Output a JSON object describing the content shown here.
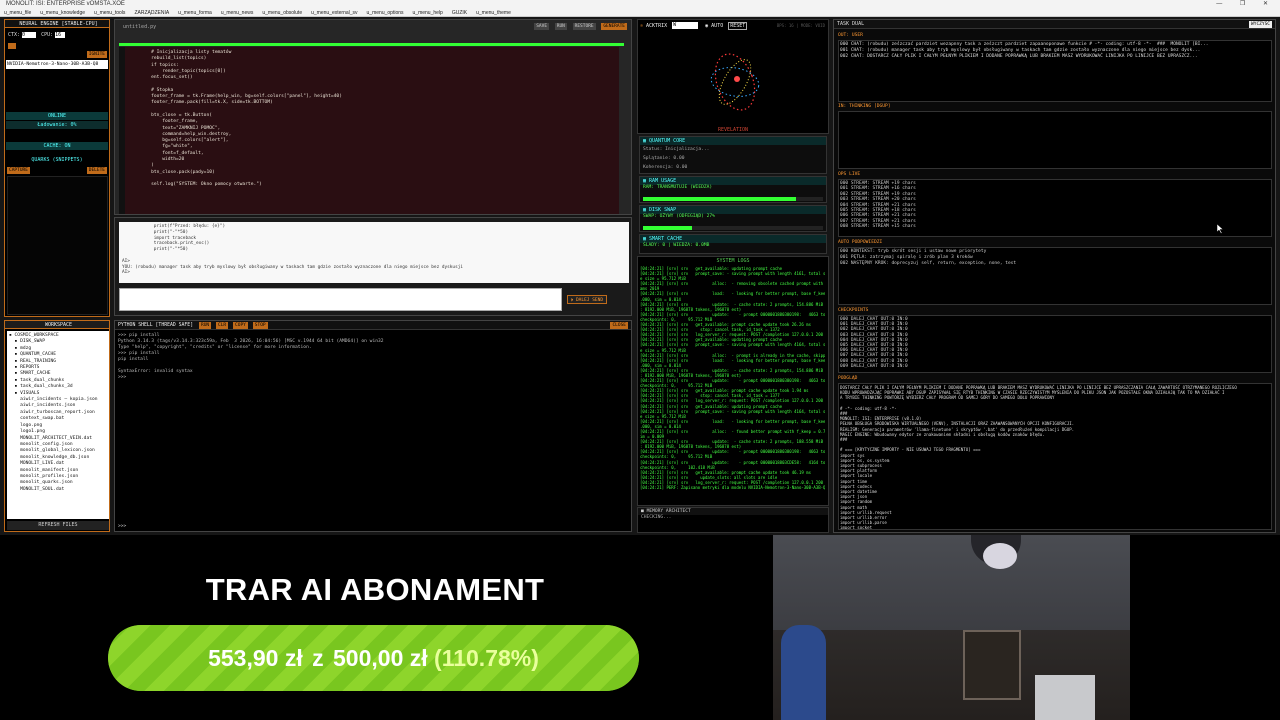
{
  "window": {
    "title": "MONOLIT: ISI: ENTERPRISE vOMSTA.XOE",
    "controls": "— ❐ ✕"
  },
  "menu": [
    "u_menu_file",
    "u_menu_knowledge",
    "u_menu_tools",
    "ZARZĄDZENIA",
    "u_menu_forma",
    "u_menu_news",
    "u_menu_obsolute",
    "u_menu_external_sv",
    "u_menu_options",
    "u_menu_help",
    "GUZIK",
    "u_menu_theme"
  ],
  "left": {
    "engine_title": "NEURAL ENGINE [STABLE-CPU]",
    "ctx_label": "CTX:",
    "ctx_value": "0",
    "cpu_label": "CPU:",
    "cpu_value": "16",
    "ignite_label": "IGNITE",
    "model_name": "NVIDIA-Nemotron-3-Nano-30B-A3B-Q8",
    "status_online": "ONLINE",
    "status_loading": "Ładowanie: 0%",
    "cache_status": "CACHE: ON",
    "quarks_title": "QUARKS (SNIPPETS)",
    "capture_label": "CAPTURE",
    "delete_label": "DELETE",
    "workspace_title": "WORKSPACE",
    "tree": [
      "▪ COSMIC_WORKSPACE",
      "  ▪ DISK_SWAP",
      "  ▪ mdzg",
      "  ▪ QUANTUM_CACHE",
      "  ▪ REAL_TRAINING",
      "  ▪ REPORTS",
      "  ▪ SMART_CACHE",
      "  ▪ task_dual_chunks",
      "  ▪ task_dual_chunks_3d",
      "  ▪ VISUALS",
      "    aiwir_incidents — kopia.json",
      "    aiwir_incidents.json",
      "    aiwir_turboscan_report.json",
      "    context_swap.bat",
      "    logo.png",
      "    logo1.png",
      "    MONOLIT_ARCHITECT_VEIN.dat",
      "    monolit_config.json",
      "    monolit_global_lexicon.json",
      "    monolit_knowledge_db.json",
      "    MONOLIT_LIVE.dat",
      "    monolit_manifest.json",
      "    monolit_profiles.json",
      "    monolit_quarks.json",
      "    MONOLIT_SOUL.dat"
    ],
    "refresh_label": "REFRESH FILES"
  },
  "editor": {
    "filename": "untitled.py",
    "tabs": [
      "SAVE",
      "RUN",
      "RESTORE",
      "GENERATE"
    ],
    "code": "        # Inicjalizacja listy tematów\n        rebuild_list(topics)\n        if topics:\n            render_topic(topics[0])\n        ent.focus_set()\n\n        # Stopka\n        footer_frame = tk.Frame(help_win, bg=self.colors[\"panel\"], height=40)\n        footer_frame.pack(fill=tk.X, side=tk.BOTTOM)\n\n        btn_close = tk.Button(\n            footer_frame,\n            text=\"ZAMKNIJ POMOC\",\n            command=help_win.destroy,\n            bg=self.colors[\"alert\"],\n            fg=\"white\",\n            font=f_default,\n            width=20\n        )\n        btn_close.pack(pady=10)\n\n        self.log(\"SYSTEM: Okno pomocy otwarte.\")"
  },
  "chat": {
    "text": "            print(f\"Przed: błędu: {e}\")\n            print(\"-\"*50)\n            import traceback\n            traceback.print_exc()\n            print(\"-\"*50)\n\nAI>\nYOU: (robudu) manager task aby tryb myslowy był obsługiwany w taskach tam gdzie zostało wyznaczone dla niego miejsce bez dyskusji\nAI>",
    "input_placeholder": "",
    "send_label": "⏵ DALEJ SEND"
  },
  "shell": {
    "title": "PYTHON SHELL [THREAD SAFE]",
    "buttons": [
      "RUN",
      "CLR",
      "COPY",
      "STOP"
    ],
    "close": "CLOSE",
    "output": ">>> pip install\nPython 3.14.3 (tags/v3.14.3:323c59a, Feb  3 2026, 16:04:56) [MSC v.1944 64 bit (AMD64)] on win32\nType \"help\", \"copyright\", \"credits\" or \"license\" for more information.\n>>> pip install\npip install\n\nSyntaxError: invalid syntax\n>>>",
    "prompt": ">>>"
  },
  "monitor": {
    "title": "ACKTRIX",
    "input_value": "W",
    "auto_label": "AUTO",
    "reset_label": "RESET",
    "stats": "BPS: 16  |  MODE: VOID",
    "revelation": "REVELATION",
    "quantum_title": "QUANTUM CORE",
    "quantum_lines": [
      "Status: Inicjalizacja...",
      "Splątanie: 0.00",
      "Koherencja: 0.00"
    ],
    "ram_title": "RAM USAGE",
    "ram_line": "RAM: TRANSMUTUJE (WIEDZA)",
    "ram_fill": 0.85,
    "disk_title": "DISK SWAP",
    "disk_line": "SWAP: OŻYWY (ODFEGIĄD) 27%",
    "disk_fill": 0.27,
    "cache_title": "SMART CACHE",
    "cache_line": "ŚLADY: 0 | WIEDZA: 0.0MB",
    "logs_title": "SYSTEM LOGS",
    "logs": [
      "[04:24:21] [srv] srv   get_available: updating prompt cache",
      "[04:24:21] [srv] srv   prompt_save: - saving prompt with length 4161, total stat",
      "e size = 95.712 MiB",
      "[04:24:21] [srv] srv          alloc:  - removing obsolete cached prompt with (ngr",
      "ams 2019",
      "[04:24:21] [srv] srv          load:   - looking for better prompt, base f_keep = 1",
      ".000, sim = 0.014",
      "[04:24:21] [srv] srv          update:  - cache state: 2 prompts, 154.886 MiB (limit",
      ": 8192.000 MiB, 196878 tokens, 196878 est)",
      "[04:24:21] [srv] srv          update:    - prompt 0000001880380198:   4663 tokens,",
      "checkpoints: 0,     95.712 MiB",
      "[04:24:21] [srv] srv   get_available: prompt cache update took 26.26 ms",
      "[04:24:21] [srv] srv     stop: cancel task, id_task = 1372",
      "[04:24:21] [srv] srv   log_server_r: request: POST /completion 127.0.0.1 200",
      "[04:24:21] [srv] srv   get_available: updating prompt cache",
      "[04:24:21] [srv] srv   prompt_save: - saving prompt with length 4164, total stat",
      "e size = 95.712 MiB",
      "[04:24:21] [srv] srv          alloc:  - prompt is already in the cache, skipping",
      "[04:24:21] [srv] srv          load:   - looking for better prompt, base f_keep = 1",
      ".000, sim = 0.014",
      "[04:24:21] [srv] srv          update:  - cache state: 2 prompts, 154.886 MiB (limit",
      ": 8192.000 MiB, 196878 tokens, 196878 est)",
      "[04:24:21] [srv] srv          update:    - prompt 0000001880380198:   4663 tokens,",
      "checkpoints: 0,     95.712 MiB",
      "[04:24:21] [srv] srv   get_available: prompt cache update took 1.94 ms",
      "[04:24:21] [srv] srv     stop: cancel task, id_task = 1377",
      "[04:24:21] [srv] srv   log_server_r: request: POST /completion 127.0.0.1 200",
      "[04:24:21] [srv] srv   get_available: updating prompt cache",
      "[04:24:21] [srv] srv   prompt_save: - saving prompt with length 4164, total stat",
      "e size = 95.712 MiB",
      "[04:24:21] [srv] srv          load:   - looking for better prompt, base f_keep = 1",
      ".000, sim = 0.014",
      "[04:24:21] [srv] srv          alloc:  - found better prompt with f_keep = 0.780, s",
      "im = 0.009",
      "[04:24:21] [srv] srv          update:  - cache state: 2 prompts, 188.558 MiB (limit",
      ": 8192.000 MiB, 196878 tokens, 196878 est)",
      "[04:24:21] [srv] srv          update:    - prompt 0000001880380198:   4663 tokens,",
      "checkpoints: 0,     95.712 MiB",
      "[04:24:21] [srv] srv          update:    - prompt 00000018803CDE58:   4164 tokens,",
      "checkpoints: 0,     102.418 MiB",
      "[04:24:21] [srv] srv   get_available: prompt cache update took 46.19 ms",
      "[04:24:21] [srv] srv     update_slots: all slots are idle",
      "[04:24:21] [srv] srv   log_server_r: request: POST /completion 127.0.0.1 200",
      "[04:24:21] PERF: Zapisano metryki dla modelu NVIDIA-Nemotron-3-Nano-30B-A3B-Q8"
    ],
    "memory_title": "MEMORY ARCHITECT",
    "memory_status": "CHECKING..."
  },
  "right": {
    "title": "TASK DUAL",
    "clear_label": "WYCZYŚĆ",
    "out_user_title": "OUT: USER",
    "out_user": "000 CHAT: (robudu) ześzczać pardziet wezapnny task a ześzczt pardziet zapaanoponawe funkcie # -*- coding: utf-8 -*-  ###  MONOLIT [BI...\n001 CHAT: (robudu) manager task aby tryb myslowy był obsługiwany w taskach tam gdzie zostało wyznaczone dla niego miejsce bez dysk...\n002 CHAT: DOSTARCZ CAŁY PLIK I CAŁYM PEŁNYM PLIKIEM I DODANE POPRAWKĄ LUB BRAKIEM MASZ WYDRUKOWAĆ LINIJKA PO LINIJCE BEZ UPRASZCZ...",
    "thinking_title": "IN: THINKING [DGUP]",
    "ops_title": "OPS LIVE",
    "ops": "000 STREAM: STREAM +19 chars\n001 STREAM: STREAM +16 chars\n002 STREAM: STREAM +19 chars\n003 STREAM: STREAM +20 chars\n004 STREAM: STREAM +21 chars\n005 STREAM: STREAM +18 chars\n006 STREAM: STREAM +21 chars\n007 STREAM: STREAM +21 chars\n008 STREAM: STREAM +15 chars",
    "auto_title": "AUTO PODPOWIEDZI",
    "auto": "000 KONTEKST: tryb skrót sesji i ustaw nowe priorytety\n001 PĘTLA: zatrzymaj spiralę i zrób plan 3 kroków\n002 NASTĘPNY KROK: doprecyzuj self, return, exception, none, test",
    "checkpoints_title": "CHECKPOINTS",
    "checkpoints": "000 DALEJ_CHAT OUT:0 IN:0\n001 DALEJ_CHAT OUT:0 IN:0\n002 DALEJ_CHAT OUT:0 IN:0\n003 DALEJ_CHAT OUT:0 IN:0\n004 DALEJ_CHAT OUT:0 IN:0\n005 DALEJ_CHAT OUT:0 IN:0\n006 DALEJ_CHAT OUT:0 IN:0\n007 DALEJ_CHAT OUT:0 IN:0\n008 DALEJ_CHAT OUT:0 IN:0\n009 DALEJ_CHAT OUT:0 IN:0",
    "podglad_title": "PODGLĄD",
    "podglad": "DOSTARCZ CAŁY PLIK I CAŁYM PEŁNYM PLIKIEM I DODANE POPRAWKĄ LUB BRAKIEM MASZ WYDRUKOWAĆ LINIJKA PO LINIJCE BEZ UPRASZCZANIA CAŁĄ ZAWARTOŚĆ OTRZYMANEGO ROZLICZEGO\nKODU WPROWADZAJĄC POPRAWKI ABY DGUP ZAPISYWAŁ SIĘ RTYB THINKING W CZASIE RZECZYWISTYM MYŚLENIA DO PLIKU JSON JAK POZOSTAŁE OKNA DZIAŁAJĄ TAK TO MA DZIAŁAĆ I\nA TRYBIE THINKING POWTÓRZĘ WYBIERZ CAŁY PROGRAM OD SAMEJ GÓRY DO SAMEGO DOŁU POPRAWIONY\n\n# -*- coding: utf-8 -*-\n###\nMONOLIT: ISI: ENTERPRISE (v8.1.0)\nPEŁNA OBSŁUGA ŚRODOWISKA WIRTUALNEGO (VENV), INSTALACJI ORAZ ZAAWANSOWANYCH OPCJI KONFIGURACJI.\nREALISM: Generacja parametrów 'llama-finetune' i skryptów '.bat' do przedłużeń kompilacji DGUP.\nMAGIC ENGINE: Wbudowany edytor ze znakowaniem składni i obsługą kodów znaków błędu.\n###\n\n# === [KRYTYCZNE IMPORTY - NIE USUWAJ TEGO FRAGMENTU] ===\nimport sys\nimport os, os.system\nimport subprocess\nimport platform\nimport locale\nimport time\nimport codecs\nimport datetime\nimport json\nimport random\nimport math\nimport urllib.request\nimport urllib.error\nimport urllib.parse\nimport socket"
  },
  "overlay": {
    "headline": "TRAR AI ABONAMENT",
    "amount": "553,90 zł",
    "connector": "z",
    "goal": "500,00 zł",
    "percent": "(110.78%)",
    "progress": 1.0
  }
}
